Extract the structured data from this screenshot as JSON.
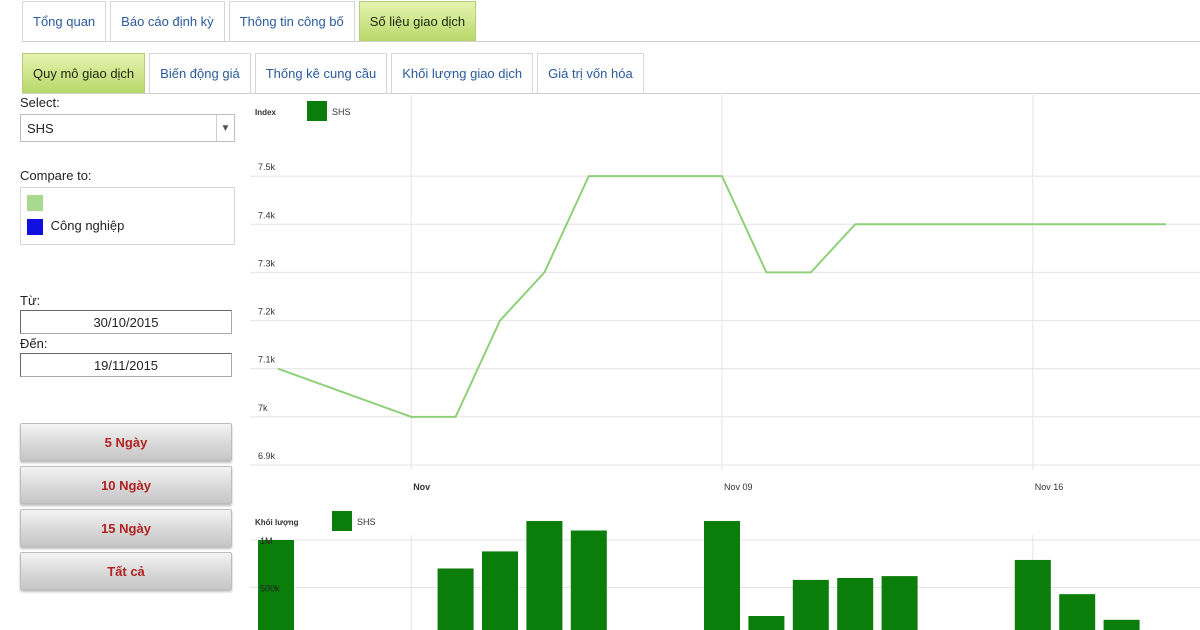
{
  "tabs_main": [
    "Tổng quan",
    "Báo cáo định kỳ",
    "Thông tin công bố",
    "Số liệu giao dịch"
  ],
  "tabs_main_active": 3,
  "tabs_sub": [
    "Quy mô giao dịch",
    "Biến động giá",
    "Thống kê cung cầu",
    "Khối lượng giao dịch",
    "Giá trị vốn hóa"
  ],
  "tabs_sub_active": 0,
  "sidebar": {
    "select_label": "Select:",
    "select_value": "SHS",
    "compare_label": "Compare to:",
    "compare_items": [
      {
        "label": "",
        "color": "#a9d88f"
      },
      {
        "label": "Công nghiệp",
        "color": "#1010e0"
      }
    ],
    "from_label": "Từ:",
    "from_value": "30/10/2015",
    "to_label": "Đến:",
    "to_value": "19/11/2015",
    "buttons": [
      "5 Ngày",
      "10 Ngày",
      "15 Ngày",
      "Tất cả"
    ]
  },
  "colors": {
    "line": "#8fd07a",
    "bar": "#0a7d0a",
    "legend": "#0a7d0a",
    "grid": "#e4e4e4",
    "tab_active": "#c6e07c",
    "button_text": "#b22222"
  },
  "chart_data": [
    {
      "type": "line",
      "ylabel": "Index",
      "series": [
        {
          "name": "SHS",
          "x": [
            "2015-10-30",
            "2015-11-02",
            "2015-11-03",
            "2015-11-04",
            "2015-11-05",
            "2015-11-06",
            "2015-11-09",
            "2015-11-10",
            "2015-11-11",
            "2015-11-12",
            "2015-11-13",
            "2015-11-16",
            "2015-11-17",
            "2015-11-18",
            "2015-11-19"
          ],
          "values": [
            7100,
            7000,
            7000,
            7200,
            7300,
            7500,
            7500,
            7300,
            7300,
            7400,
            7400,
            7400,
            7400,
            7400,
            7400
          ]
        }
      ],
      "y_ticks": [
        "6.9k",
        "7k",
        "7.1k",
        "7.2k",
        "7.3k",
        "7.4k",
        "7.5k"
      ],
      "ylim": [
        6900,
        7600
      ],
      "x_ticks": [
        "Nov",
        "Nov 09",
        "Nov 16"
      ],
      "grid": true,
      "legend": "top-left"
    },
    {
      "type": "bar",
      "ylabel": "Khối lượng",
      "series": [
        {
          "name": "SHS",
          "x": [
            "2015-10-30",
            "2015-11-03",
            "2015-11-04",
            "2015-11-05",
            "2015-11-06",
            "2015-11-09",
            "2015-11-10",
            "2015-11-11",
            "2015-11-12",
            "2015-11-13",
            "2015-11-16",
            "2015-11-17",
            "2015-11-18"
          ],
          "values": [
            1000000,
            700000,
            880000,
            1200000,
            1100000,
            1200000,
            200000,
            580000,
            600000,
            620000,
            790000,
            430000,
            160000
          ]
        }
      ],
      "y_ticks": [
        "1M",
        "500k"
      ],
      "grid": true,
      "legend": "top-left"
    }
  ]
}
